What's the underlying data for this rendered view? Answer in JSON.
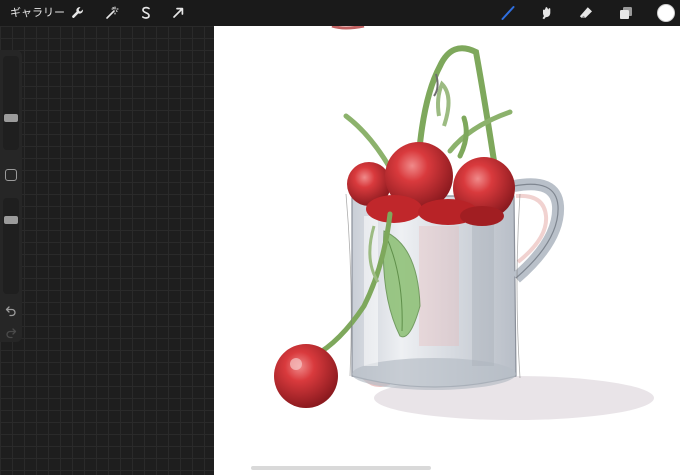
{
  "toolbar": {
    "gallery_label": "ギャラリー",
    "left_tools": [
      "wrench-icon",
      "magic-wand-icon",
      "selection-s-icon",
      "transform-arrow-icon"
    ],
    "right_tools": [
      "brush-icon",
      "smudge-icon",
      "eraser-icon",
      "layers-icon",
      "color-icon"
    ],
    "active_tool": "brush-icon",
    "active_color": "#2f6fe0",
    "current_color": "#ffffff"
  },
  "sidebar": {
    "brush_size_level": 0.35,
    "opacity_level": 0.2,
    "items": [
      "brush-size-slider",
      "modifier-button",
      "opacity-slider",
      "undo-icon",
      "redo-icon"
    ]
  },
  "canvas": {
    "background": "#ffffff",
    "subject": "cherries-in-mug-sketch"
  }
}
